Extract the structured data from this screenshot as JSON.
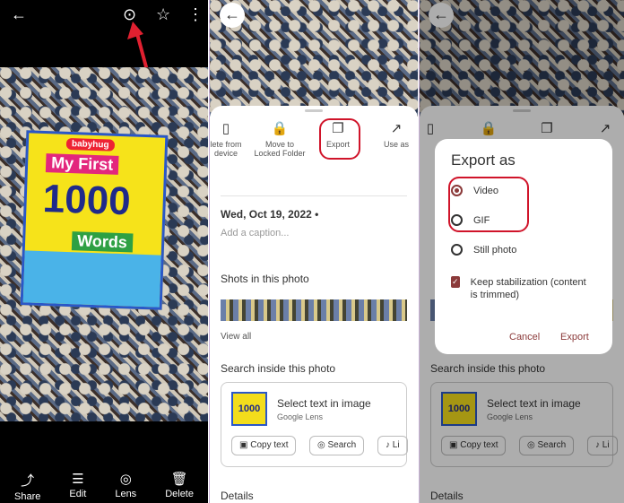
{
  "panel1": {
    "icons": {
      "back": "←",
      "motion": "⊙",
      "star": "☆",
      "menu": "⋮"
    },
    "book": {
      "brand": "babyhug",
      "line1": "My First",
      "line2": "1000",
      "line3": "Words"
    },
    "bottom": [
      {
        "icon": "⤴",
        "label": "Share"
      },
      {
        "icon": "☰",
        "label": "Edit"
      },
      {
        "icon": "◎",
        "label": "Lens"
      },
      {
        "icon": "🗑",
        "label": "Delete"
      }
    ]
  },
  "sheet": {
    "actions": [
      {
        "icon": "▯",
        "label": "lete from device"
      },
      {
        "icon": "🔒",
        "label": "Move to Locked Folder"
      },
      {
        "icon": "❐",
        "label": "Export"
      },
      {
        "icon": "↗",
        "label": "Use as"
      }
    ],
    "date": "Wed, Oct 19, 2022 •",
    "caption_placeholder": "Add a caption...",
    "shots_heading": "Shots in this photo",
    "view_all": "View all",
    "search_heading": "Search inside this photo",
    "lens_title": "Select text in image",
    "lens_sub": "Google Lens",
    "lens_thumb": "1000",
    "chips": [
      "Copy text",
      "Search",
      "Li"
    ],
    "details": "Details"
  },
  "dialog": {
    "title": "Export as",
    "options": [
      {
        "label": "Video",
        "selected": true
      },
      {
        "label": "GIF",
        "selected": false
      },
      {
        "label": "Still photo",
        "selected": false
      }
    ],
    "checkbox_label": "Keep stabilization (content is trimmed)",
    "checked": true,
    "cancel": "Cancel",
    "export": "Export"
  },
  "colors": {
    "highlight": "#d0142a",
    "accent": "#8b3a3a"
  }
}
